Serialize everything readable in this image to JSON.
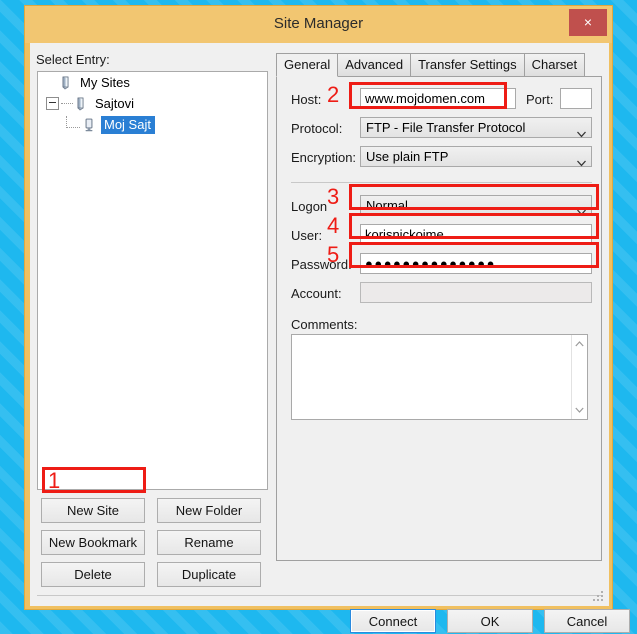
{
  "window": {
    "title": "Site Manager",
    "close_label": "×"
  },
  "left": {
    "select_entry_label": "Select Entry:",
    "tree": [
      {
        "label": "My Sites",
        "icon": "server-folder-icon",
        "level": 0,
        "selected": false
      },
      {
        "label": "Sajtovi",
        "icon": "server-folder-icon",
        "level": 1,
        "selected": false
      },
      {
        "label": "Moj Sajt",
        "icon": "server-icon",
        "level": 2,
        "selected": true
      }
    ],
    "buttons": [
      {
        "label": "New Site",
        "name": "new-site-button"
      },
      {
        "label": "New Folder",
        "name": "new-folder-button"
      },
      {
        "label": "New Bookmark",
        "name": "new-bookmark-button"
      },
      {
        "label": "Rename",
        "name": "rename-button"
      },
      {
        "label": "Delete",
        "name": "delete-button"
      },
      {
        "label": "Duplicate",
        "name": "duplicate-button"
      }
    ]
  },
  "tabs": [
    {
      "label": "General",
      "active": true
    },
    {
      "label": "Advanced",
      "active": false
    },
    {
      "label": "Transfer Settings",
      "active": false
    },
    {
      "label": "Charset",
      "active": false
    }
  ],
  "general": {
    "host_label": "Host:",
    "host_value": "www.mojdomen.com",
    "port_label": "Port:",
    "port_value": "",
    "port_placeholder": "",
    "protocol_label": "Protocol:",
    "protocol_value": "FTP - File Transfer Protocol",
    "encryption_label": "Encryption:",
    "encryption_value": "Use plain FTP",
    "logon_label": "Logon",
    "logon_value": "Normal",
    "user_label": "User:",
    "user_value": "korisnickoime",
    "password_label": "Password:",
    "password_value": "●●●●●●●●●●●●●●",
    "account_label": "Account:",
    "account_value": "",
    "comments_label": "Comments:",
    "comments_value": ""
  },
  "footer": {
    "connect_label": "Connect",
    "ok_label": "OK",
    "cancel_label": "Cancel"
  },
  "annotations": [
    {
      "number": "1",
      "target": "new-site-button"
    },
    {
      "number": "2",
      "target": "host-input"
    },
    {
      "number": "3",
      "target": "logon-combo"
    },
    {
      "number": "4",
      "target": "user-input"
    },
    {
      "number": "5",
      "target": "password-input"
    }
  ],
  "colors": {
    "desktop": "#1eb8ef",
    "window_frame": "#f0c060",
    "close_button": "#c0504d",
    "selection": "#2a7fd4",
    "annotation": "#ee1c15"
  }
}
